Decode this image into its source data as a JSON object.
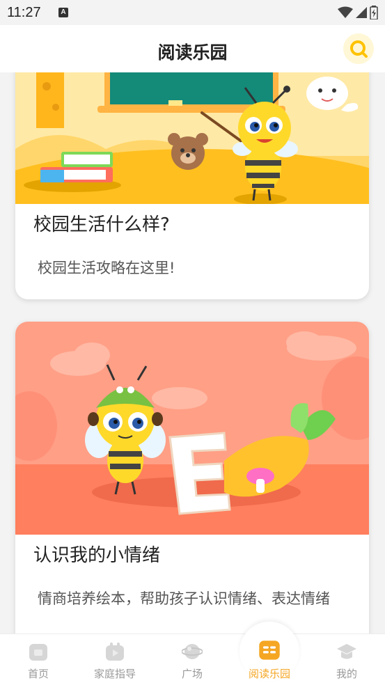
{
  "status_bar": {
    "time": "11:27",
    "notification_glyph": "A"
  },
  "header": {
    "title": "阅读乐园",
    "search_icon": "search-icon"
  },
  "cards": [
    {
      "title": "校园生活什么样?",
      "description": "校园生活攻略在这里!"
    },
    {
      "title": "认识我的小情绪",
      "description": "情商培养绘本，帮助孩子认识情绪、表达情绪"
    }
  ],
  "bottom_nav": {
    "items": [
      {
        "label": "首页",
        "icon": "home-icon",
        "active": false
      },
      {
        "label": "家庭指导",
        "icon": "family-guide-icon",
        "active": false
      },
      {
        "label": "广场",
        "icon": "planet-icon",
        "active": false
      },
      {
        "label": "阅读乐园",
        "icon": "book-icon",
        "active": true
      },
      {
        "label": "我的",
        "icon": "graduation-cap-icon",
        "active": false
      }
    ]
  },
  "colors": {
    "accent": "#f5a623",
    "inactive": "#999999",
    "card1_bg": "#ffc62a",
    "card2_bg": "#ff8b6f"
  }
}
